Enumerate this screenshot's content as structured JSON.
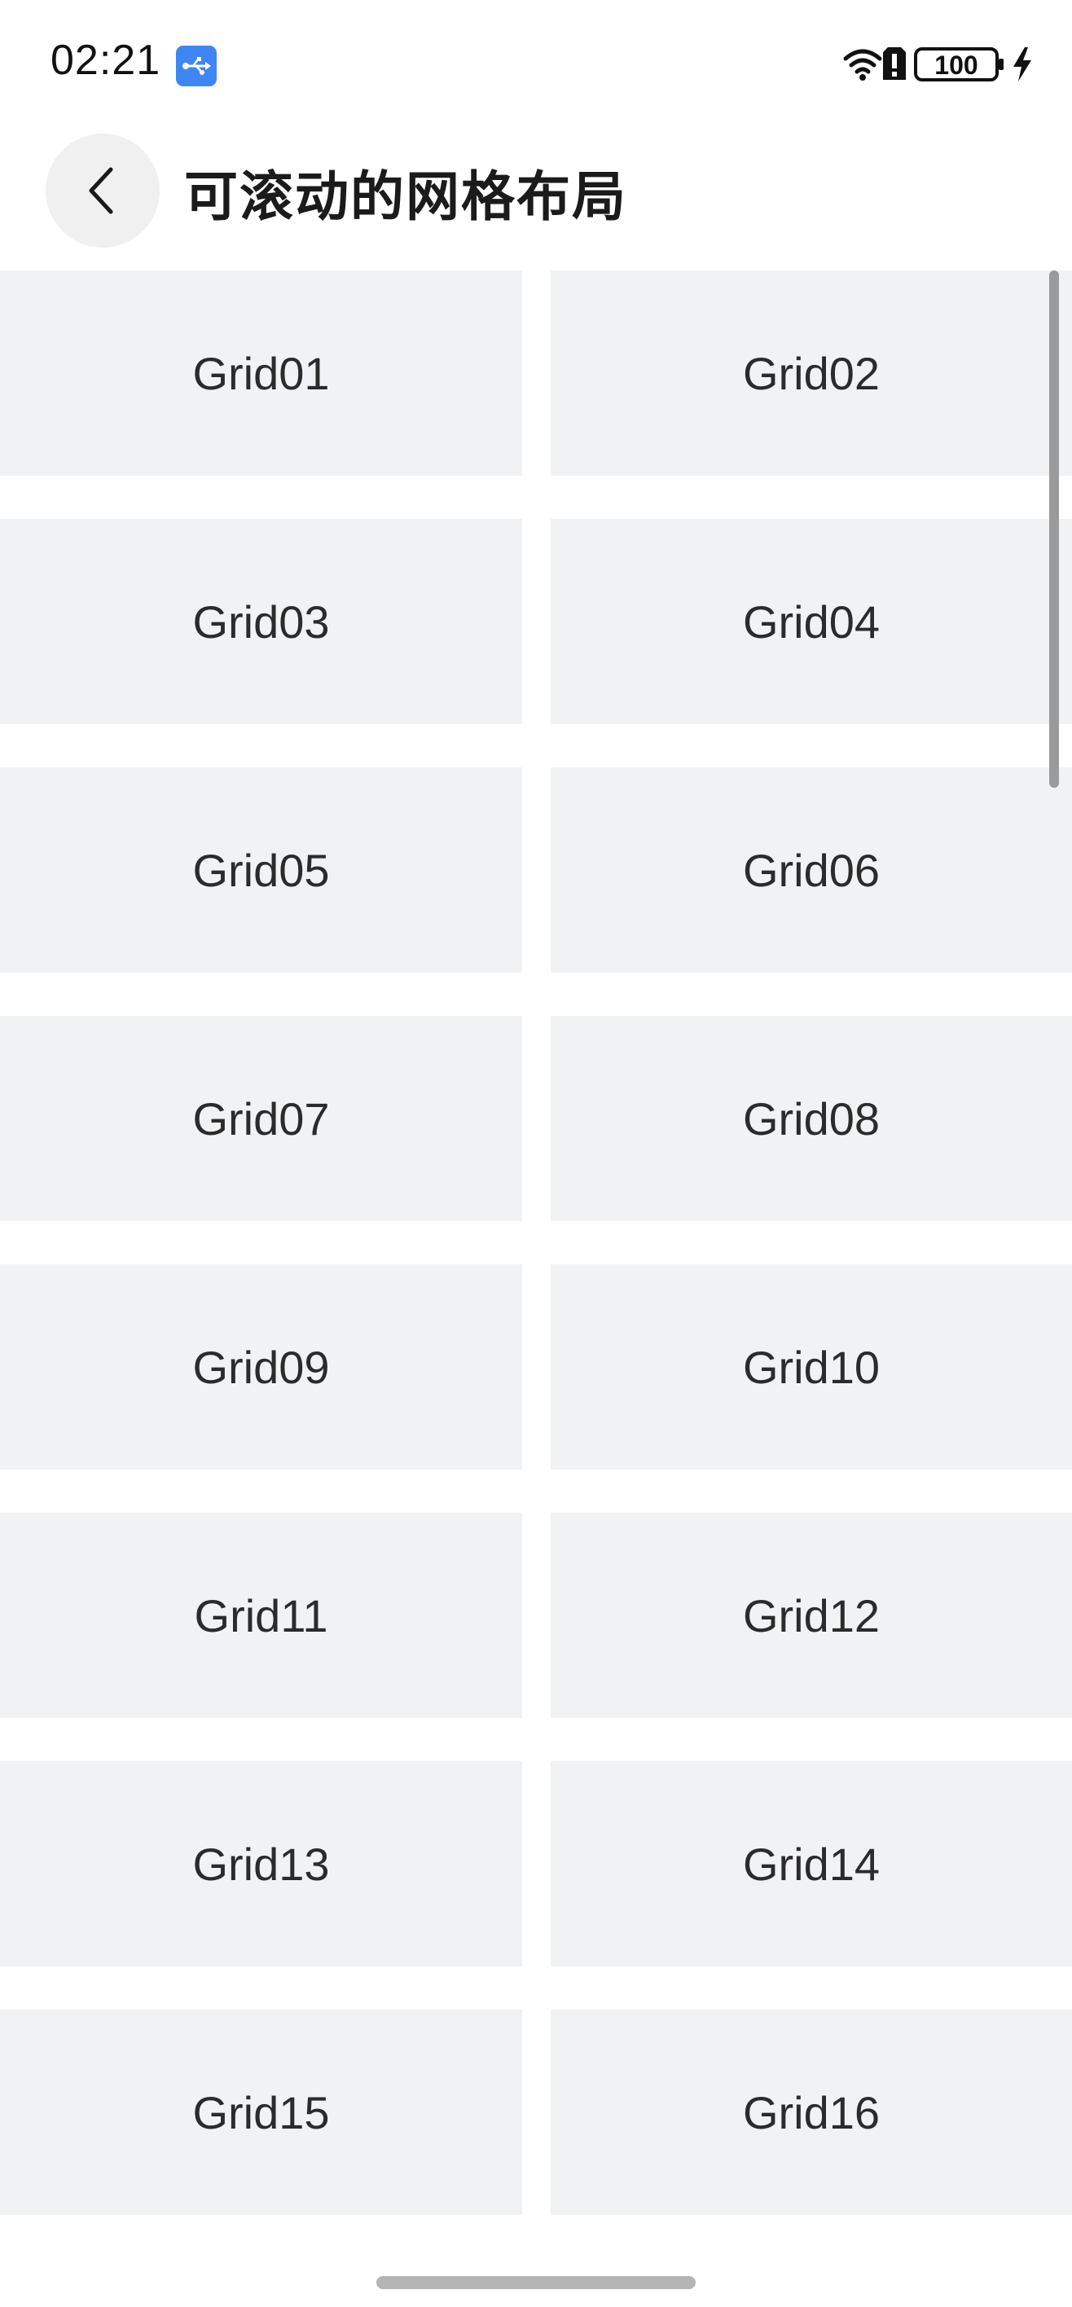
{
  "status_bar": {
    "time": "02:21",
    "battery": "100",
    "icons": [
      "usb-icon",
      "wifi-icon",
      "alert-icon",
      "battery-icon",
      "charging-icon"
    ],
    "usb_badge_color": "#3f86f3"
  },
  "header": {
    "title": "可滚动的网格布局",
    "back_icon": "chevron-left-icon"
  },
  "grid": {
    "items": [
      "Grid01",
      "Grid02",
      "Grid03",
      "Grid04",
      "Grid05",
      "Grid06",
      "Grid07",
      "Grid08",
      "Grid09",
      "Grid10",
      "Grid11",
      "Grid12",
      "Grid13",
      "Grid14",
      "Grid15",
      "Grid16"
    ],
    "item_background": "#f1f2f3"
  }
}
